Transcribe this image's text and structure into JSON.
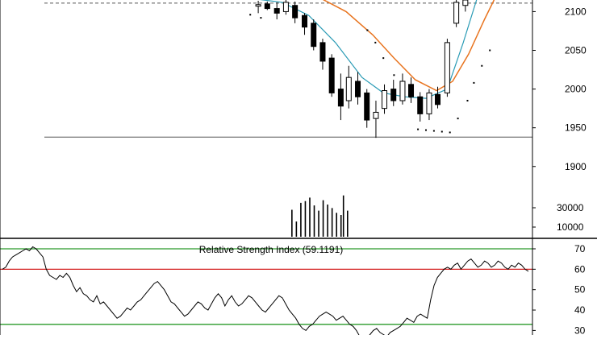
{
  "chart_data": [
    {
      "type": "candlestick",
      "panel": "price",
      "price_ticks": [
        2100,
        2050,
        2000,
        1950,
        1900
      ],
      "volume_ticks": [
        "30000",
        "10000"
      ],
      "price_range": [
        1880,
        2115
      ],
      "resistance_level": 2111,
      "support_level": 1938,
      "candles": [
        {
          "x": 0.485,
          "o": 2107,
          "c": 2109,
          "h": 2114,
          "l": 2098
        },
        {
          "x": 0.502,
          "o": 2110,
          "c": 2104,
          "h": 2113,
          "l": 2102
        },
        {
          "x": 0.52,
          "o": 2104,
          "c": 2098,
          "h": 2112,
          "l": 2090
        },
        {
          "x": 0.537,
          "o": 2100,
          "c": 2112,
          "h": 2115,
          "l": 2096
        },
        {
          "x": 0.554,
          "o": 2108,
          "c": 2092,
          "h": 2113,
          "l": 2085
        },
        {
          "x": 0.572,
          "o": 2095,
          "c": 2080,
          "h": 2098,
          "l": 2070
        },
        {
          "x": 0.589,
          "o": 2085,
          "c": 2055,
          "h": 2090,
          "l": 2050
        },
        {
          "x": 0.606,
          "o": 2060,
          "c": 2036,
          "h": 2065,
          "l": 2025
        },
        {
          "x": 0.623,
          "o": 2040,
          "c": 1995,
          "h": 2045,
          "l": 1990
        },
        {
          "x": 0.64,
          "o": 2000,
          "c": 1978,
          "h": 2020,
          "l": 1960
        },
        {
          "x": 0.655,
          "o": 1985,
          "c": 2015,
          "h": 2030,
          "l": 1975
        },
        {
          "x": 0.672,
          "o": 2010,
          "c": 1990,
          "h": 2022,
          "l": 1980
        },
        {
          "x": 0.689,
          "o": 1995,
          "c": 1960,
          "h": 2000,
          "l": 1950
        },
        {
          "x": 0.706,
          "o": 1962,
          "c": 1970,
          "h": 1985,
          "l": 1937
        },
        {
          "x": 0.722,
          "o": 1975,
          "c": 1998,
          "h": 2006,
          "l": 1968
        },
        {
          "x": 0.739,
          "o": 2000,
          "c": 1985,
          "h": 2012,
          "l": 1978
        },
        {
          "x": 0.756,
          "o": 1985,
          "c": 2010,
          "h": 2020,
          "l": 1980
        },
        {
          "x": 0.772,
          "o": 2006,
          "c": 1990,
          "h": 2015,
          "l": 1982
        },
        {
          "x": 0.789,
          "o": 1990,
          "c": 1968,
          "h": 1996,
          "l": 1958
        },
        {
          "x": 0.806,
          "o": 1968,
          "c": 1995,
          "h": 2000,
          "l": 1960
        },
        {
          "x": 0.822,
          "o": 1993,
          "c": 1980,
          "h": 2003,
          "l": 1975
        },
        {
          "x": 0.84,
          "o": 1995,
          "c": 2060,
          "h": 2065,
          "l": 1990
        },
        {
          "x": 0.857,
          "o": 2085,
          "c": 2112,
          "h": 2115,
          "l": 2080
        },
        {
          "x": 0.874,
          "o": 2108,
          "c": 2115,
          "h": 2116,
          "l": 2100
        }
      ],
      "ma_short": [
        [
          0.46,
          2118
        ],
        [
          0.53,
          2112
        ],
        [
          0.58,
          2095
        ],
        [
          0.63,
          2060
        ],
        [
          0.68,
          2015
        ],
        [
          0.72,
          1995
        ],
        [
          0.76,
          1990
        ],
        [
          0.8,
          1988
        ],
        [
          0.84,
          2000
        ],
        [
          0.87,
          2060
        ],
        [
          0.895,
          2115
        ]
      ],
      "ma_long": [
        [
          0.6,
          2118
        ],
        [
          0.65,
          2100
        ],
        [
          0.7,
          2070
        ],
        [
          0.74,
          2040
        ],
        [
          0.78,
          2012
        ],
        [
          0.82,
          1998
        ],
        [
          0.85,
          2010
        ],
        [
          0.88,
          2045
        ],
        [
          0.91,
          2090
        ],
        [
          0.93,
          2118
        ]
      ],
      "sar_points": [
        [
          0.47,
          2096
        ],
        [
          0.49,
          2092
        ],
        [
          0.69,
          2076
        ],
        [
          0.705,
          2060
        ],
        [
          0.72,
          2040
        ],
        [
          0.74,
          2018
        ],
        [
          0.755,
          2005
        ],
        [
          0.77,
          1990
        ],
        [
          0.785,
          1948
        ],
        [
          0.8,
          1947
        ],
        [
          0.815,
          1946
        ],
        [
          0.83,
          1945
        ],
        [
          0.845,
          1944
        ],
        [
          0.86,
          1962
        ],
        [
          0.878,
          1985
        ],
        [
          0.89,
          2008
        ],
        [
          0.905,
          2030
        ],
        [
          0.92,
          2050
        ]
      ],
      "volume_bars": [
        [
          0.85,
          0.62
        ],
        [
          0.863,
          0.35
        ],
        [
          0.876,
          0.78
        ],
        [
          0.889,
          0.82
        ],
        [
          0.902,
          0.9
        ],
        [
          0.915,
          0.72
        ],
        [
          0.928,
          0.6
        ],
        [
          0.941,
          0.84
        ],
        [
          0.954,
          0.74
        ],
        [
          0.967,
          0.66
        ],
        [
          0.98,
          0.55
        ],
        [
          0.993,
          0.5
        ],
        [
          1.0,
          0.95
        ],
        [
          1.012,
          0.6
        ]
      ],
      "volume_max": 45000
    },
    {
      "type": "line",
      "panel": "rsi",
      "title": "Relative Strength Index (59.1191)",
      "y_ticks": [
        70,
        60,
        50,
        40,
        30
      ],
      "ylim": [
        25,
        75
      ],
      "levels": {
        "upper_green": 70,
        "upper_red": 60,
        "lower_green": 33,
        "lower_red": 25
      },
      "values": [
        60,
        61,
        64,
        66,
        67,
        68,
        69,
        70,
        69,
        71,
        70,
        68,
        66,
        60,
        57,
        56,
        55,
        57,
        56,
        58,
        56,
        52,
        49,
        51,
        48,
        47,
        45,
        44,
        47,
        43,
        44,
        42,
        40,
        38,
        36,
        37,
        39,
        41,
        40,
        42,
        44,
        45,
        47,
        49,
        51,
        53,
        54,
        52,
        50,
        47,
        44,
        43,
        41,
        39,
        37,
        38,
        40,
        42,
        44,
        43,
        41,
        40,
        43,
        46,
        48,
        46,
        42,
        45,
        47,
        44,
        42,
        43,
        45,
        47,
        46,
        44,
        42,
        40,
        39,
        41,
        43,
        45,
        47,
        46,
        43,
        40,
        38,
        36,
        33,
        31,
        30,
        32,
        33,
        35,
        37,
        38,
        39,
        38,
        37,
        35,
        36,
        37,
        35,
        33,
        32,
        30,
        27,
        25,
        26,
        28,
        30,
        31,
        29,
        28,
        27,
        29,
        30,
        31,
        32,
        34,
        36,
        35,
        34,
        37,
        38,
        37,
        36,
        45,
        52,
        56,
        58,
        60,
        61,
        60,
        62,
        63,
        60,
        62,
        64,
        65,
        63,
        61,
        62,
        64,
        63,
        61,
        62,
        64,
        63,
        61,
        60,
        62,
        61,
        63,
        62,
        60,
        59
      ]
    }
  ]
}
